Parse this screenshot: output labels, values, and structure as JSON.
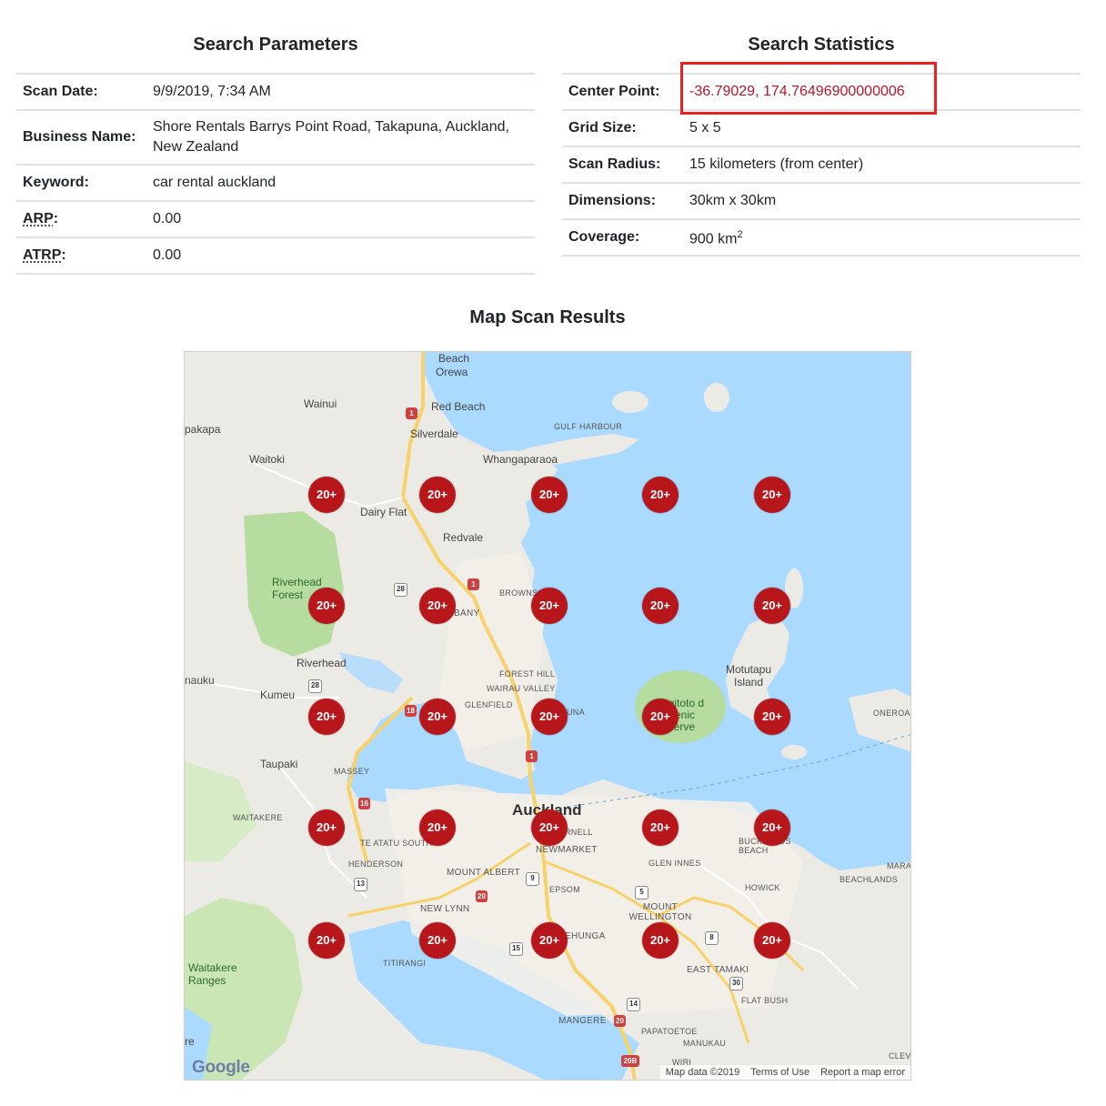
{
  "search_parameters": {
    "title": "Search Parameters",
    "rows": [
      {
        "label": "Scan Date:",
        "value": "9/9/2019, 7:34 AM"
      },
      {
        "label": "Business Name:",
        "value": "Shore Rentals Barrys Point Road, Takapuna, Auckland, New Zealand"
      },
      {
        "label": "Keyword:",
        "value": "car rental auckland"
      },
      {
        "label": "ARP",
        "label_suffix": ":",
        "value": "0.00"
      },
      {
        "label": "ATRP",
        "label_suffix": ":",
        "value": "0.00"
      }
    ]
  },
  "search_statistics": {
    "title": "Search Statistics",
    "rows": [
      {
        "label": "Center Point:",
        "value": "-36.79029, 174.76496900000006"
      },
      {
        "label": "Grid Size:",
        "value": "5 x 5"
      },
      {
        "label": "Scan Radius:",
        "value": "15 kilometers (from center)"
      },
      {
        "label": "Dimensions:",
        "value": "30km x 30km"
      },
      {
        "label": "Coverage:",
        "value": "900 km",
        "value_sup": "2"
      }
    ],
    "highlight_color": "#e8221e",
    "value_color": "#b5162b"
  },
  "map": {
    "title": "Map Scan Results",
    "pin_label": "20+",
    "pin_color": "#b7161b",
    "grid_rows": 5,
    "grid_cols": 5,
    "logo": "Google",
    "footer": {
      "map_data": "Map data ©2019",
      "terms": "Terms of Use",
      "report": "Report a map error"
    },
    "labels": {
      "beach": "Beach",
      "orewa": "Orewa",
      "wainui": "Wainui",
      "red_beach": "Red Beach",
      "pakapa": "pakapa",
      "silverdale": "Silverdale",
      "gulf_harbour": "GULF HARBOUR",
      "waitoki": "Waitoki",
      "whangaparaoa": "Whangaparaoa",
      "dairy_flat": "Dairy Flat",
      "redvale": "Redvale",
      "riverhead_forest": "Riverhead Forest",
      "browns_bay": "BROWNS B",
      "albany": "BANY",
      "motutapu": "Motutapu Island",
      "riverhead": "Riverhead",
      "forest_hill": "FOREST HILL",
      "wairau_valley": "WAIRAU VALLEY",
      "nauku": "nauku",
      "kumeu": "Kumeu",
      "glenfield": "GLENFIELD",
      "takapuna": "UNA",
      "rangitoto": "ngitoto d Scenic eserve",
      "onerora": "ONEROA",
      "taupaki": "Taupaki",
      "massey": "MASSEY",
      "auckland": "Auckland",
      "waitakere": "WAITAKERE",
      "te_atatu": "TE ATATU SOUTH",
      "parnell": "RNELL",
      "newmarket": "NEWMARKET",
      "bucklands_beach": "BUCKLANDS BEACH",
      "glen_innes": "GLEN INNES",
      "henderson": "HENDERSON",
      "mount_albert": "MOUNT ALBERT",
      "epsom": "EPSOM",
      "howick": "HOWICK",
      "beachlands": "BEACHLANDS",
      "marai": "MARAI",
      "new_lynn": "NEW LYNN",
      "mount_wellington": "MOUNT WELLINGTON",
      "ellerslie": "EHUNGA",
      "waitakere_ranges": "Waitakere Ranges",
      "titirangi": "TITIRANGI",
      "east_tamaki": "EAST TAMAKI",
      "flat_bush": "FLAT BUSH",
      "mangere": "MANGERE",
      "papatoetoe": "PAPATOETOE",
      "manukau": "MANUKAU",
      "clevedon": "CLEVE",
      "re": "re",
      "wiri": "WIRI"
    },
    "shields": {
      "s1a": "1",
      "s1b": "1",
      "s1c": "1",
      "s28a": "28",
      "s28b": "28",
      "s18": "18",
      "s16": "16",
      "s13": "13",
      "s20a": "20",
      "s20b": "20",
      "s9": "9",
      "s5": "5",
      "s8": "8",
      "s15": "15",
      "s14": "14",
      "s30": "30",
      "s20c": "20B"
    }
  }
}
